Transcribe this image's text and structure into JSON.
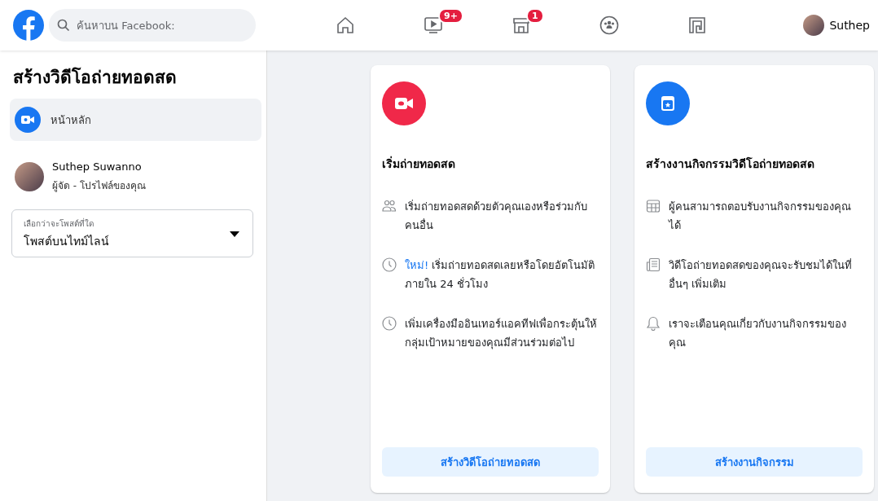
{
  "topbar": {
    "search": {
      "placeholder": "ค้นหาบน Facebook:"
    },
    "nav": [
      {
        "kind": "home"
      },
      {
        "kind": "video",
        "badge": "9+"
      },
      {
        "kind": "store",
        "badge": "1"
      },
      {
        "kind": "groups"
      },
      {
        "kind": "gaming"
      }
    ],
    "profile": {
      "name": "Suthep"
    }
  },
  "sidebar": {
    "title": "สร้างวิดีโอถ่ายทอดสด",
    "items": [
      {
        "label": "หน้าหลัก",
        "selected": true
      }
    ],
    "host": {
      "name": "Suthep Suwanno",
      "role": "ผู้จัด - โปรไฟล์ของคุณ"
    },
    "post_select": {
      "label": "เลือกว่าจะโพสต์ที่ใด",
      "value": "โพสต์บนไทม์ไลน์"
    }
  },
  "cards": [
    {
      "kind": "live",
      "title": "เริ่มถ่ายทอดสด",
      "features": [
        {
          "kind": "people",
          "text": "เริ่มถ่ายทอดสดด้วยตัวคุณเองหรือร่วมกับคนอื่น"
        },
        {
          "kind": "clock",
          "tag": "ใหม่!",
          "text": "เริ่มถ่ายทอดสดเลยหรือโดยอัตโนมัติภายใน 24 ชั่วโมง"
        },
        {
          "kind": "clock",
          "text": "เพิ่มเครื่องมืออินเทอร์แอคทีฟเพื่อกระตุ้นให้กลุ่มเป้าหมายของคุณมีส่วนร่วมต่อไป"
        }
      ],
      "button": "สร้างวิดีโอถ่ายทอดสด"
    },
    {
      "kind": "event",
      "title": "สร้างงานกิจกรรมวิดีโอถ่ายทอดสด",
      "features": [
        {
          "kind": "calendar",
          "text": "ผู้คนสามารถตอบรับงานกิจกรรมของคุณได้"
        },
        {
          "kind": "news",
          "text": "วิดีโอถ่ายทอดสดของคุณจะรับชมได้ในที่อื่นๆ เพิ่มเติม"
        },
        {
          "kind": "bell",
          "text": "เราจะเตือนคุณเกี่ยวกับงานกิจกรรมของคุณ"
        }
      ],
      "button": "สร้างงานกิจกรรม"
    }
  ]
}
